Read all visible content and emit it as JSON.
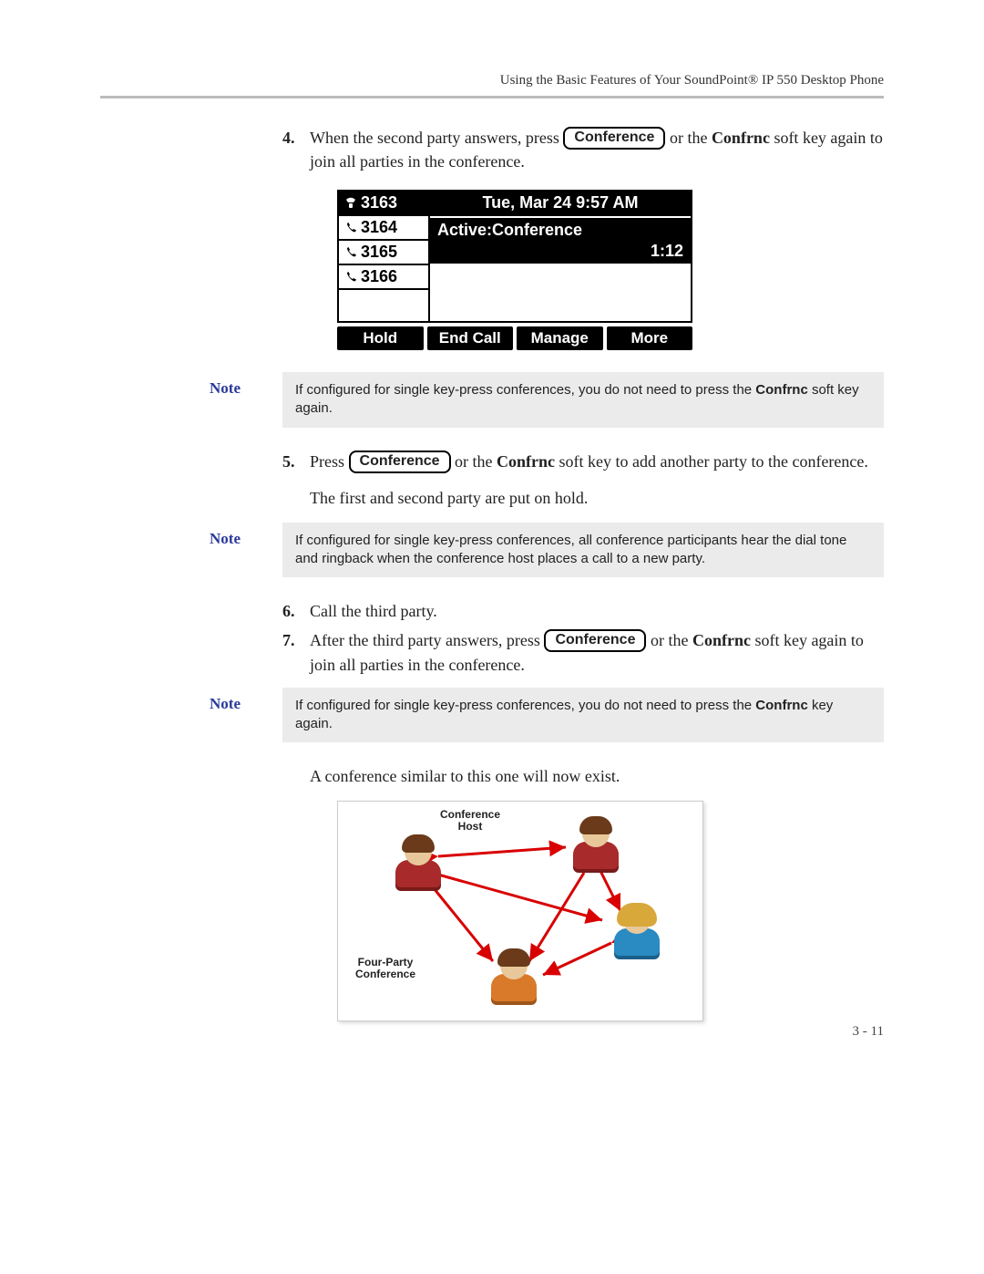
{
  "header": {
    "running": "Using the Basic Features of Your SoundPoint® IP 550 Desktop Phone"
  },
  "key_label": "Conference",
  "confrnc": "Confrnc",
  "steps": {
    "s4": {
      "num": "4.",
      "pre": "When the second party answers, press ",
      "post_a": " or the ",
      "post_b": " soft key again to join all parties in the conference."
    },
    "s5": {
      "num": "5.",
      "pre": "Press ",
      "post_a": " or the ",
      "post_b": " soft key to add another party to the conference.",
      "follow": "The first and second party are put on hold."
    },
    "s6": {
      "num": "6.",
      "text": "Call the third party."
    },
    "s7": {
      "num": "7.",
      "pre": "After the third party answers, press ",
      "post_a": " or the ",
      "post_b": " soft key again to join all parties in the conference."
    }
  },
  "notes": {
    "label": "Note",
    "n1_a": "If configured for single key-press conferences, you do not need to press the ",
    "n1_b": " soft key again.",
    "n2": "If configured for single key-press conferences, all conference participants hear the dial tone and ringback when the conference host places a call to a new party.",
    "n3_a": "If configured for single key-press conferences, you do not need to press the ",
    "n3_b": " key again."
  },
  "screen": {
    "lines": [
      "3163",
      "3164",
      "3165",
      "3166"
    ],
    "datetime": "Tue, Mar 24  9:57 AM",
    "status": "Active:Conference",
    "timer": "1:12",
    "softkeys": [
      "Hold",
      "End Call",
      "Manage",
      "More"
    ]
  },
  "closing": "A conference similar to this one will now exist.",
  "diagram": {
    "host_label": "Conference\nHost",
    "title": "Four-Party\nConference"
  },
  "page_num": "3 - 11"
}
